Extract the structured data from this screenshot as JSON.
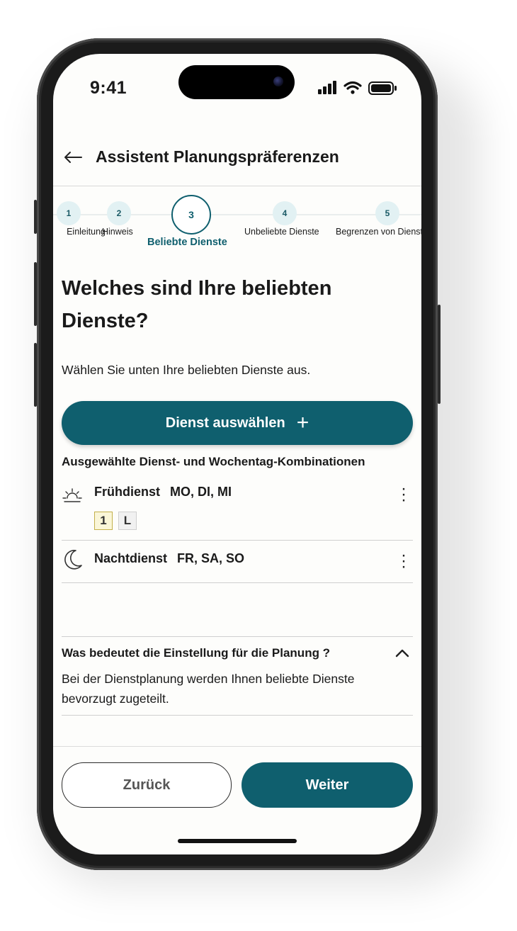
{
  "status_bar": {
    "time": "9:41"
  },
  "header": {
    "title": "Assistent Planungspräferenzen"
  },
  "stepper": {
    "steps": [
      {
        "number": "1",
        "label": "Einleitung"
      },
      {
        "number": "2",
        "label": "Hinweis"
      },
      {
        "number": "3",
        "label": "Beliebte Dienste"
      },
      {
        "number": "4",
        "label": "Unbeliebte Dienste"
      },
      {
        "number": "5",
        "label": "Begrenzen von Diensten"
      }
    ],
    "active_step": 3
  },
  "main": {
    "heading": "Welches sind Ihre beliebten Dienste?",
    "subtitle": "Wählen Sie unten Ihre beliebten Dienste aus.",
    "select_button": "Dienst auswählen",
    "selected_label": "Ausgewählte Dienst- und Wochentag-Kombinationen",
    "shifts": [
      {
        "name": "Frühdienst",
        "days": "MO, DI, MI",
        "icon": "sunrise-icon",
        "badges": [
          "1",
          "L"
        ]
      },
      {
        "name": "Nachtdienst",
        "days": "FR, SA, SO",
        "icon": "moon-icon",
        "badges": []
      }
    ]
  },
  "faq": {
    "question": "Was bedeutet die Einstellung für die Planung ?",
    "answer": "Bei der Dienstplanung werden Ihnen beliebte Dienste bevorzugt zugeteilt."
  },
  "footer": {
    "back_label": "Zurück",
    "next_label": "Weiter"
  },
  "colors": {
    "primary": "#0f5f6e",
    "step_circle": "#e2f1f3",
    "badge_yellow": "#faf6d8"
  }
}
